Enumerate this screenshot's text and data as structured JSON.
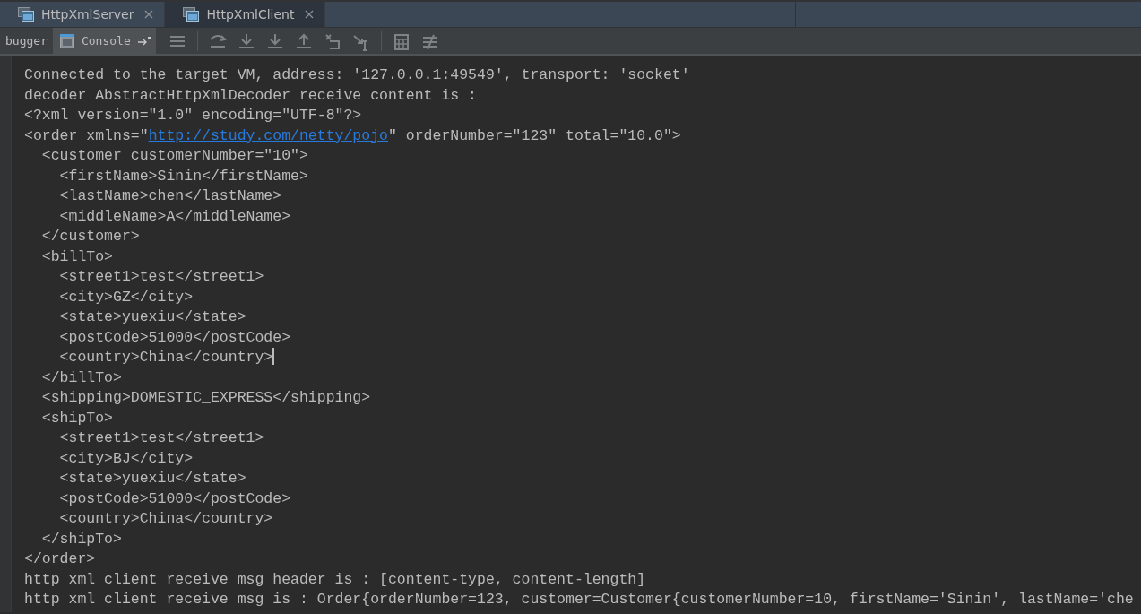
{
  "editor_tabs": [
    {
      "label": "HttpXmlServer",
      "selected": false
    },
    {
      "label": "HttpXmlClient",
      "selected": true
    }
  ],
  "debug_tabs": [
    {
      "label": "bugger",
      "selected": false,
      "kind": "text"
    },
    {
      "label": "Console",
      "selected": true,
      "kind": "console"
    }
  ],
  "console_lines": [
    {
      "text": "Connected to the target VM, address: '127.0.0.1:49549', transport: 'socket'"
    },
    {
      "text": "decoder AbstractHttpXmlDecoder receive content is :"
    },
    {
      "text": "<?xml version=\"1.0\" encoding=\"UTF-8\"?>"
    },
    {
      "parts": [
        {
          "text": "<order xmlns=\"",
          "kind": "plain"
        },
        {
          "text": "http://study.com/netty/pojo",
          "kind": "link"
        },
        {
          "text": "\" orderNumber=\"123\" total=\"10.0\">",
          "kind": "plain"
        }
      ]
    },
    {
      "text": "  <customer customerNumber=\"10\">"
    },
    {
      "text": "    <firstName>Sinin</firstName>"
    },
    {
      "text": "    <lastName>chen</lastName>"
    },
    {
      "text": "    <middleName>A</middleName>"
    },
    {
      "text": "  </customer>"
    },
    {
      "text": "  <billTo>"
    },
    {
      "text": "    <street1>test</street1>"
    },
    {
      "text": "    <city>GZ</city>"
    },
    {
      "text": "    <state>yuexiu</state>"
    },
    {
      "text": "    <postCode>51000</postCode>"
    },
    {
      "text": "    <country>China</country>",
      "cursor": true
    },
    {
      "text": "  </billTo>"
    },
    {
      "text": "  <shipping>DOMESTIC_EXPRESS</shipping>"
    },
    {
      "text": "  <shipTo>"
    },
    {
      "text": "    <street1>test</street1>"
    },
    {
      "text": "    <city>BJ</city>"
    },
    {
      "text": "    <state>yuexiu</state>"
    },
    {
      "text": "    <postCode>51000</postCode>"
    },
    {
      "text": "    <country>China</country>"
    },
    {
      "text": "  </shipTo>"
    },
    {
      "text": "</order>"
    },
    {
      "text": "http xml client receive msg header is : [content-type, content-length]"
    },
    {
      "text": "http xml client receive msg is : Order{orderNumber=123, customer=Customer{customerNumber=10, firstName='Sinin', lastName='che"
    }
  ]
}
